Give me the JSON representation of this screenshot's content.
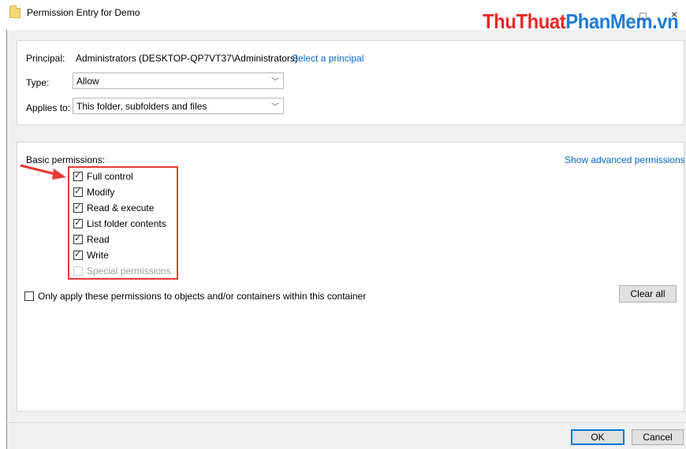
{
  "window": {
    "title": "Permission Entry for Demo"
  },
  "brand": {
    "part1": "ThuThuat",
    "part2": "PhanMem",
    "part3": ".vn"
  },
  "principal": {
    "label": "Principal:",
    "value": "Administrators (DESKTOP-QP7VT37\\Administrators)",
    "link": "Select a principal"
  },
  "type": {
    "label": "Type:",
    "value": "Allow"
  },
  "applies_to": {
    "label": "Applies to:",
    "value": "This folder, subfolders and files"
  },
  "permissions": {
    "heading": "Basic permissions:",
    "advanced_link": "Show advanced permissions",
    "items": [
      {
        "label": "Full control",
        "checked": true,
        "disabled": false
      },
      {
        "label": "Modify",
        "checked": true,
        "disabled": false
      },
      {
        "label": "Read & execute",
        "checked": true,
        "disabled": false
      },
      {
        "label": "List folder contents",
        "checked": true,
        "disabled": false
      },
      {
        "label": "Read",
        "checked": true,
        "disabled": false
      },
      {
        "label": "Write",
        "checked": true,
        "disabled": false
      },
      {
        "label": "Special permissions",
        "checked": false,
        "disabled": true
      }
    ],
    "only_apply_label": "Only apply these permissions to objects and/or containers within this container",
    "only_apply_checked": false,
    "clear_all": "Clear all"
  },
  "footer": {
    "ok": "OK",
    "cancel": "Cancel"
  },
  "colors": {
    "accent": "#0066cc",
    "highlight": "#e53935"
  }
}
